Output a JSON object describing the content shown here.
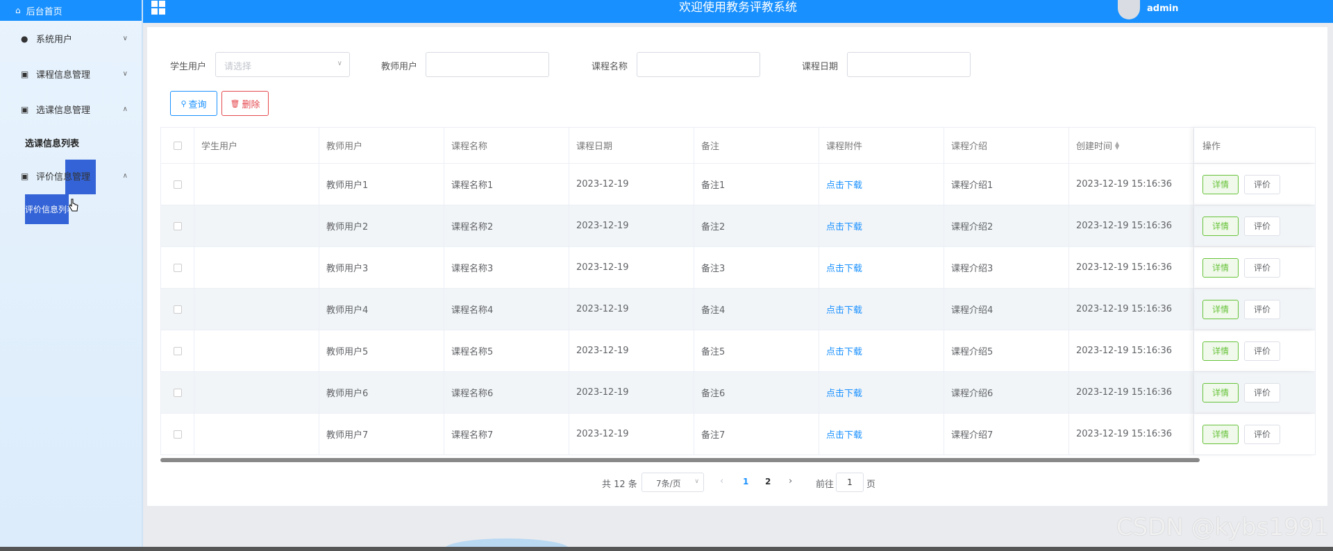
{
  "sidebar": {
    "home": "后台首页",
    "menus": [
      {
        "label": "系统用户",
        "icon": "user-icon"
      },
      {
        "label": "课程信息管理",
        "icon": "clipboard-icon"
      },
      {
        "label": "选课信息管理",
        "icon": "clipboard-icon"
      },
      {
        "label": "评价信息管理",
        "icon": "clipboard-icon"
      }
    ],
    "sub_course_select": "选课信息列表",
    "sub_evaluation": "评价信息列表"
  },
  "header": {
    "title": "欢迎使用教务评教系统",
    "username": "admin"
  },
  "filters": {
    "student_label": "学生用户",
    "student_placeholder": "请选择",
    "teacher_label": "教师用户",
    "course_name_label": "课程名称",
    "course_date_label": "课程日期"
  },
  "buttons": {
    "query": "查询",
    "delete": "删除"
  },
  "table": {
    "columns": [
      "学生用户",
      "教师用户",
      "课程名称",
      "课程日期",
      "备注",
      "课程附件",
      "课程介绍",
      "创建时间",
      "操作"
    ],
    "rows": [
      {
        "student": "",
        "teacher": "教师用户1",
        "course": "课程名称1",
        "date": "2023-12-19",
        "note": "备注1",
        "attachment": "点击下载",
        "intro": "课程介绍1",
        "created": "2023-12-19 15:16:36"
      },
      {
        "student": "",
        "teacher": "教师用户2",
        "course": "课程名称2",
        "date": "2023-12-19",
        "note": "备注2",
        "attachment": "点击下载",
        "intro": "课程介绍2",
        "created": "2023-12-19 15:16:36"
      },
      {
        "student": "",
        "teacher": "教师用户3",
        "course": "课程名称3",
        "date": "2023-12-19",
        "note": "备注3",
        "attachment": "点击下载",
        "intro": "课程介绍3",
        "created": "2023-12-19 15:16:36"
      },
      {
        "student": "",
        "teacher": "教师用户4",
        "course": "课程名称4",
        "date": "2023-12-19",
        "note": "备注4",
        "attachment": "点击下载",
        "intro": "课程介绍4",
        "created": "2023-12-19 15:16:36"
      },
      {
        "student": "",
        "teacher": "教师用户5",
        "course": "课程名称5",
        "date": "2023-12-19",
        "note": "备注5",
        "attachment": "点击下载",
        "intro": "课程介绍5",
        "created": "2023-12-19 15:16:36"
      },
      {
        "student": "",
        "teacher": "教师用户6",
        "course": "课程名称6",
        "date": "2023-12-19",
        "note": "备注6",
        "attachment": "点击下载",
        "intro": "课程介绍6",
        "created": "2023-12-19 15:16:36"
      },
      {
        "student": "",
        "teacher": "教师用户7",
        "course": "课程名称7",
        "date": "2023-12-19",
        "note": "备注7",
        "attachment": "点击下载",
        "intro": "课程介绍7",
        "created": "2023-12-19 15:16:36"
      }
    ],
    "detail_label": "详情",
    "rate_label": "评价"
  },
  "pagination": {
    "total": "共 12 条",
    "page_size": "7条/页",
    "pages": [
      "1",
      "2"
    ],
    "current": "1",
    "goto_label": "前往",
    "goto_value": "1",
    "page_suffix": "页"
  },
  "watermark": "CSDN @kybs1991",
  "colors": {
    "primary": "#1890ff",
    "danger": "#e5494f",
    "success": "#67c23a",
    "sidebar_active": "#3363d6"
  }
}
